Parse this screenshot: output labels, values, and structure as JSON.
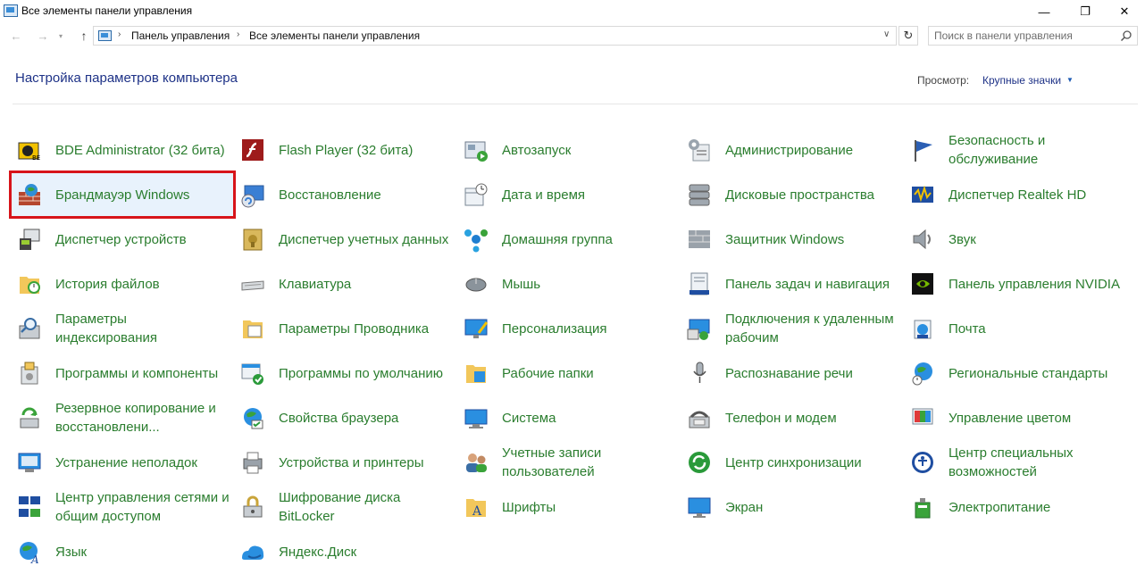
{
  "window": {
    "title": "Все элементы панели управления",
    "minimize": "—",
    "maximize": "❐",
    "close": "✕"
  },
  "nav": {
    "back": "←",
    "forward": "→",
    "recent": "▾",
    "up": "↑",
    "breadcrumbs": [
      "Панель управления",
      "Все элементы панели управления"
    ],
    "dropdown": "∨",
    "refresh": "↻",
    "search_placeholder": "Поиск в панели управления"
  },
  "header": {
    "title": "Настройка параметров компьютера",
    "view_label": "Просмотр:",
    "view_value": "Крупные значки"
  },
  "colors": {
    "link_green": "#2a7d2e",
    "title_blue": "#1e3287",
    "highlight_red": "#d7141a",
    "selected_bg": "#e8f2fc"
  },
  "items": [
    {
      "label": "BDE Administrator (32 бита)",
      "icon": "bde-admin-icon"
    },
    {
      "label": "Flash Player (32 бита)",
      "icon": "flash-player-icon"
    },
    {
      "label": "Автозапуск",
      "icon": "autoplay-icon"
    },
    {
      "label": "Администрирование",
      "icon": "administrative-tools-icon"
    },
    {
      "label": "Безопасность и обслуживание",
      "icon": "security-flag-icon"
    },
    {
      "label": "Брандмауэр Windows",
      "icon": "firewall-icon",
      "selected": true
    },
    {
      "label": "Восстановление",
      "icon": "recovery-icon"
    },
    {
      "label": "Дата и время",
      "icon": "date-time-icon"
    },
    {
      "label": "Дисковые пространства",
      "icon": "storage-spaces-icon"
    },
    {
      "label": "Диспетчер Realtek HD",
      "icon": "realtek-audio-icon"
    },
    {
      "label": "Диспетчер устройств",
      "icon": "device-manager-icon"
    },
    {
      "label": "Диспетчер учетных данных",
      "icon": "credential-manager-icon"
    },
    {
      "label": "Домашняя группа",
      "icon": "homegroup-icon"
    },
    {
      "label": "Защитник Windows",
      "icon": "windows-defender-icon"
    },
    {
      "label": "Звук",
      "icon": "sound-icon"
    },
    {
      "label": "История файлов",
      "icon": "file-history-icon"
    },
    {
      "label": "Клавиатура",
      "icon": "keyboard-icon"
    },
    {
      "label": "Мышь",
      "icon": "mouse-icon"
    },
    {
      "label": "Панель задач и навигация",
      "icon": "taskbar-icon"
    },
    {
      "label": "Панель управления NVIDIA",
      "icon": "nvidia-icon"
    },
    {
      "label": "Параметры индексирования",
      "icon": "indexing-icon"
    },
    {
      "label": "Параметры Проводника",
      "icon": "explorer-options-icon"
    },
    {
      "label": "Персонализация",
      "icon": "personalization-icon"
    },
    {
      "label": "Подключения к удаленным рабочим",
      "icon": "remote-desktop-icon"
    },
    {
      "label": "Почта",
      "icon": "mail-icon"
    },
    {
      "label": "Программы и компоненты",
      "icon": "programs-features-icon"
    },
    {
      "label": "Программы по умолчанию",
      "icon": "default-programs-icon"
    },
    {
      "label": "Рабочие папки",
      "icon": "work-folders-icon"
    },
    {
      "label": "Распознавание речи",
      "icon": "microphone-icon"
    },
    {
      "label": "Региональные стандарты",
      "icon": "region-globe-icon"
    },
    {
      "label": "Резервное копирование и восстановлени...",
      "icon": "backup-icon"
    },
    {
      "label": "Свойства браузера",
      "icon": "internet-options-icon"
    },
    {
      "label": "Система",
      "icon": "system-icon"
    },
    {
      "label": "Телефон и модем",
      "icon": "phone-modem-icon"
    },
    {
      "label": "Управление цветом",
      "icon": "color-management-icon"
    },
    {
      "label": "Устранение неполадок",
      "icon": "troubleshooting-icon"
    },
    {
      "label": "Устройства и принтеры",
      "icon": "devices-printers-icon"
    },
    {
      "label": "Учетные записи пользователей",
      "icon": "user-accounts-icon"
    },
    {
      "label": "Центр синхронизации",
      "icon": "sync-center-icon"
    },
    {
      "label": "Центр специальных возможностей",
      "icon": "ease-of-access-icon"
    },
    {
      "label": "Центр управления сетями и общим доступом",
      "icon": "network-center-icon"
    },
    {
      "label": "Шифрование диска BitLocker",
      "icon": "bitlocker-icon"
    },
    {
      "label": "Шрифты",
      "icon": "fonts-icon"
    },
    {
      "label": "Экран",
      "icon": "display-icon"
    },
    {
      "label": "Электропитание",
      "icon": "power-options-icon"
    },
    {
      "label": "Язык",
      "icon": "language-icon"
    },
    {
      "label": "Яндекс.Диск",
      "icon": "yandex-disk-icon"
    }
  ]
}
